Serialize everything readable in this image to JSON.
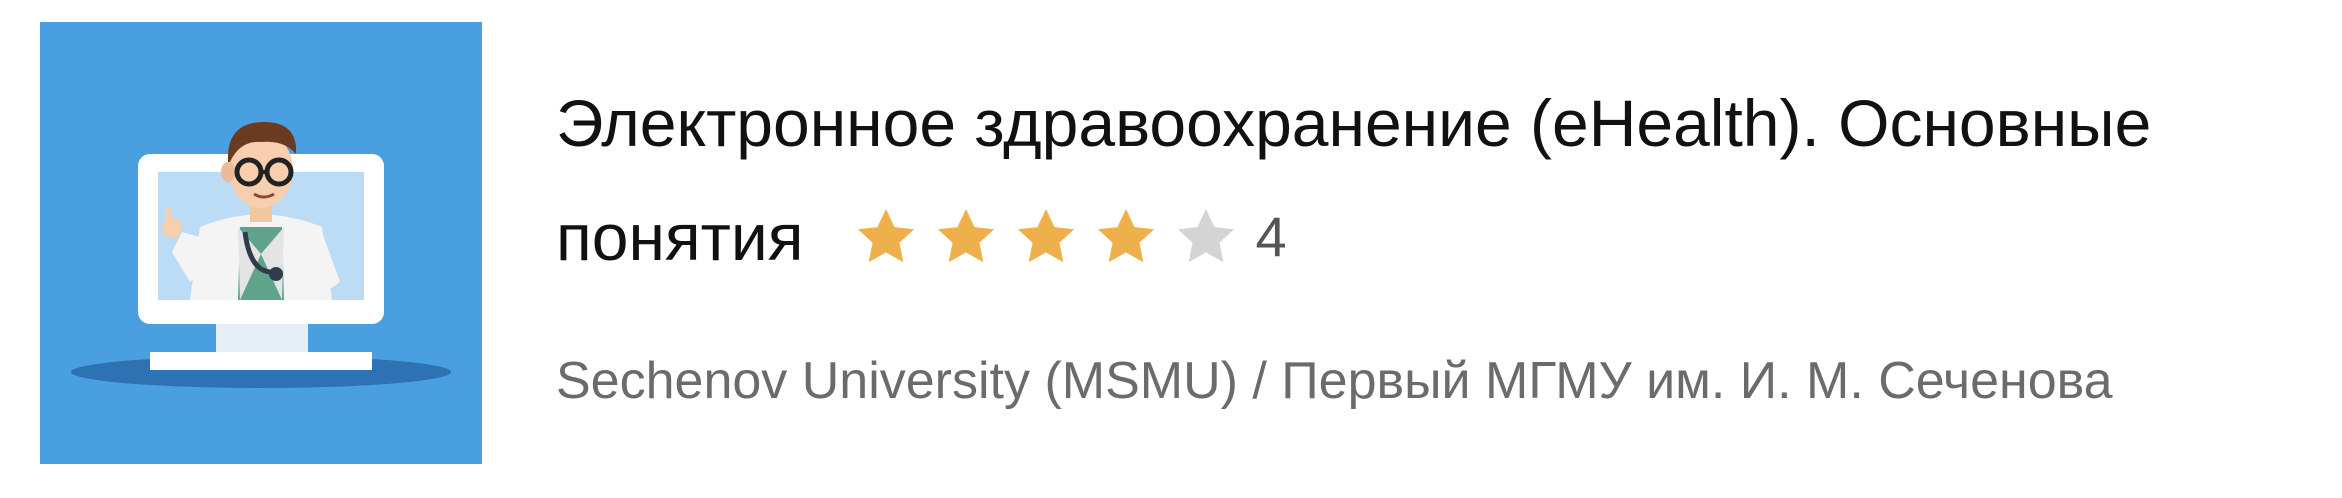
{
  "course": {
    "title_line1": "Электронное здравоохранение (eHealth). Основные",
    "title_line2": "понятия",
    "rating": {
      "value_label": "4",
      "stars_filled": 4,
      "stars_total": 5
    },
    "provider": "Sechenov University (MSMU) / Первый МГМУ им. И. М. Сеченова",
    "thumbnail_icon": "doctor-in-monitor-icon"
  },
  "colors": {
    "thumb_background": "#4a9fe0",
    "star_filled": "#eeb04a",
    "star_empty": "#d4d4d4",
    "title_text": "#111111",
    "provider_text": "#6b6b6b"
  }
}
